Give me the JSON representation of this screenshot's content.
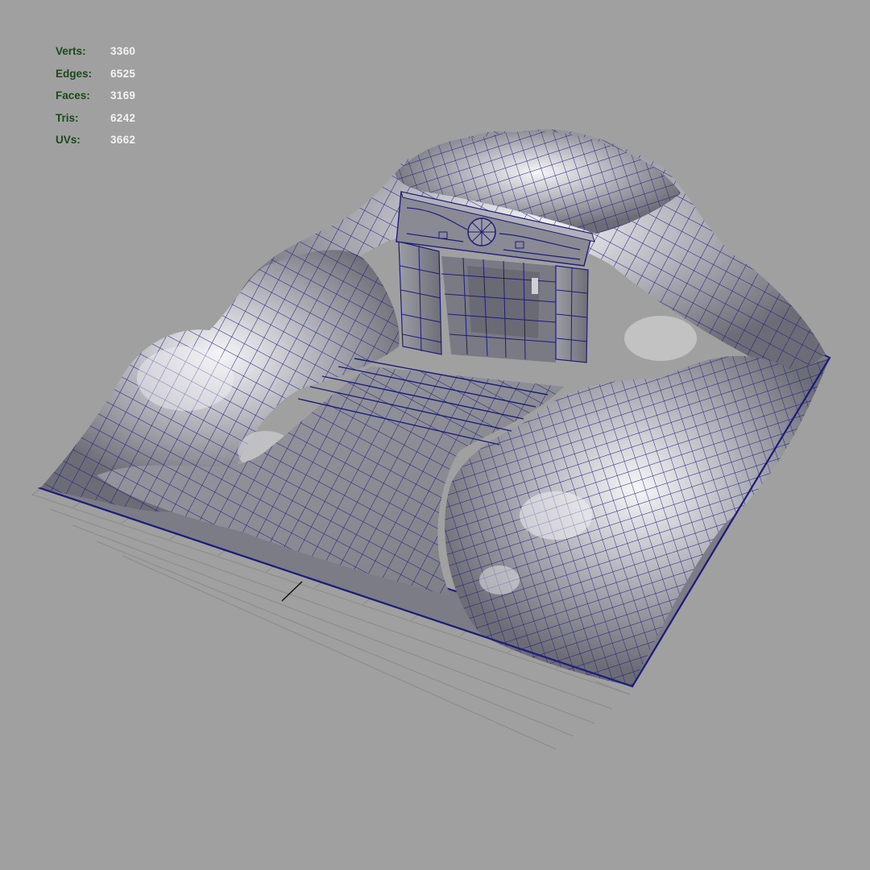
{
  "viewport": {
    "background": "#a0a0a0",
    "wire_color": "#1c1c7c",
    "grid_color": "#8a8a8a",
    "mesh_base_color": "#8c8c94",
    "mesh_highlight_color": "#f4f4f6"
  },
  "poly_count": {
    "label_color": "#1a4a1a",
    "value_color": "#f2f2f2",
    "rows": [
      {
        "label": "Verts:",
        "value": "3360"
      },
      {
        "label": "Edges:",
        "value": "6525"
      },
      {
        "label": "Faces:",
        "value": "3169"
      },
      {
        "label": "Tris:",
        "value": "6242"
      },
      {
        "label": "UVs:",
        "value": "3662"
      }
    ]
  },
  "model": {
    "icon": "wireframe-cave-mesh-icon"
  }
}
